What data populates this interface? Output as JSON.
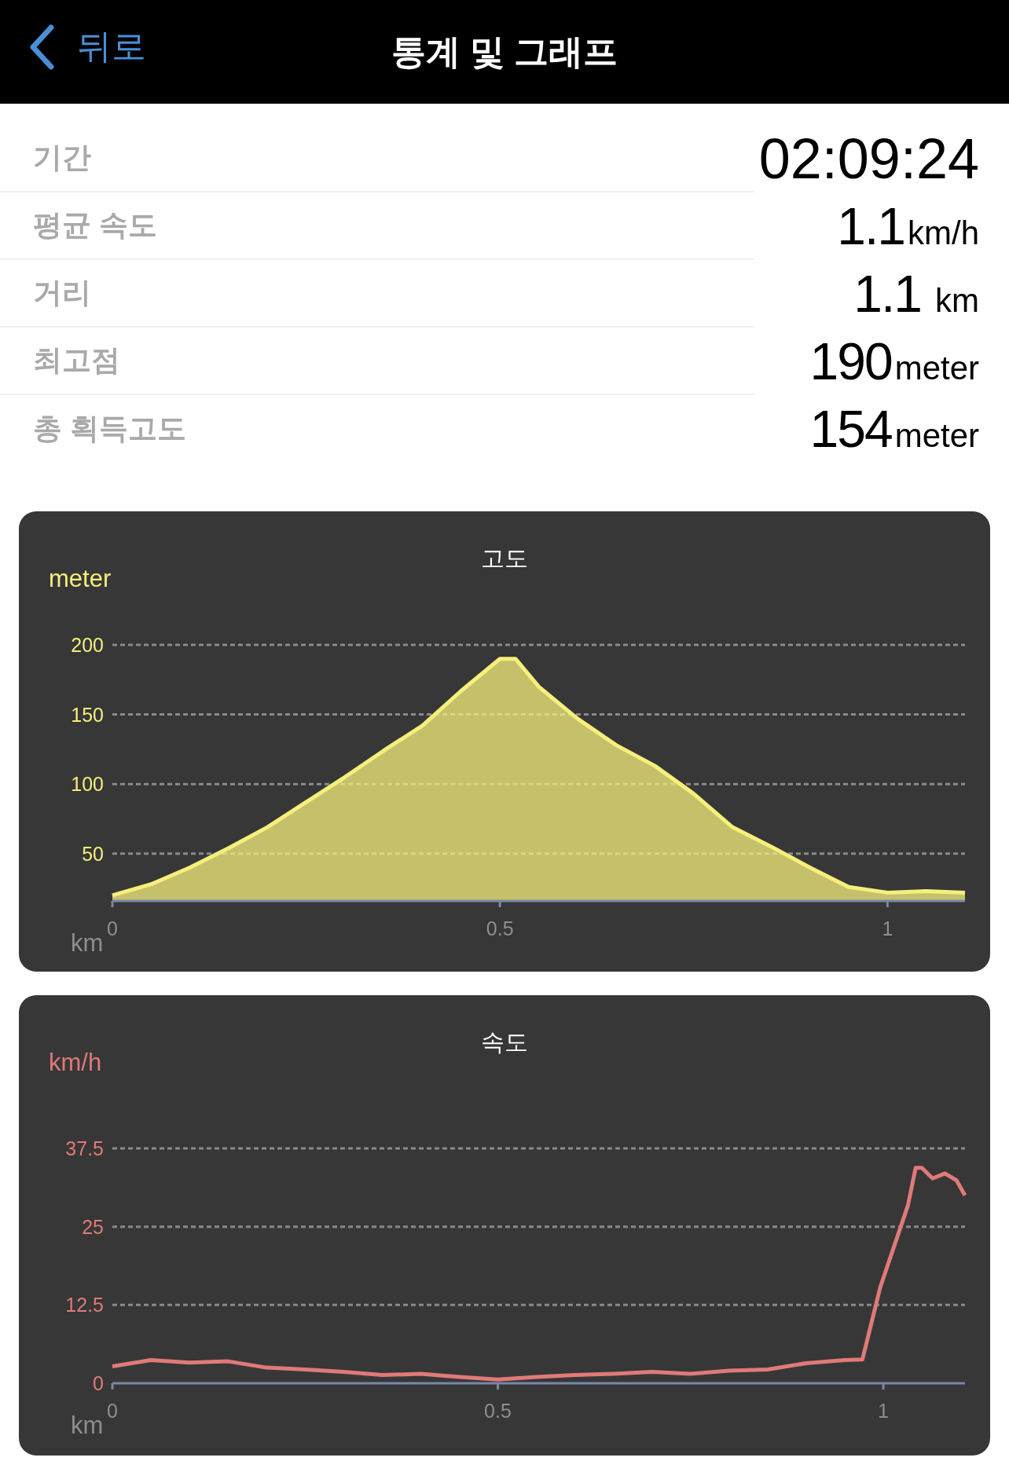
{
  "header": {
    "back_label": "뒤로",
    "title": "통계 및 그래프"
  },
  "stats": [
    {
      "label": "기간",
      "value": "02:09:24"
    },
    {
      "label": "평균 속도",
      "value": "1.1",
      "unit": "km/h"
    },
    {
      "label": "거리",
      "value": "1.1",
      "unit": "km"
    },
    {
      "label": "최고점",
      "value": "190",
      "unit": "meter"
    },
    {
      "label": "총 획득고도",
      "value": "154",
      "unit": "meter"
    }
  ],
  "charts": [
    {
      "chart_data": {
        "type": "area",
        "title": "고도",
        "xlabel": "km",
        "ylabel": "meter",
        "x": [
          0,
          0.05,
          0.1,
          0.15,
          0.2,
          0.25,
          0.3,
          0.35,
          0.4,
          0.45,
          0.5,
          0.52,
          0.55,
          0.6,
          0.65,
          0.7,
          0.75,
          0.8,
          0.85,
          0.9,
          0.95,
          1,
          1.05,
          1.1
        ],
        "series": [
          {
            "color": "#f5ef7c",
            "values": [
              20,
              28,
              40,
              54,
              69,
              87,
              105,
              124,
              142,
              167,
              190,
              190,
              170,
              147,
              128,
              113,
              93,
              69,
              55,
              40,
              26,
              22,
              23,
              22
            ]
          }
        ],
        "xlim": [
          0,
          1.1
        ],
        "ylim": [
          16,
          200
        ],
        "xticks": [
          0,
          0.5,
          1
        ],
        "yticks": [
          50,
          100,
          150,
          200
        ],
        "grid": true
      }
    },
    {
      "chart_data": {
        "type": "line",
        "title": "속도",
        "xlabel": "km",
        "ylabel": "km/h",
        "x": [
          0,
          0.05,
          0.1,
          0.15,
          0.2,
          0.25,
          0.3,
          0.35,
          0.4,
          0.45,
          0.5,
          0.55,
          0.6,
          0.65,
          0.7,
          0.75,
          0.8,
          0.85,
          0.9,
          0.95,
          0.973,
          0.996,
          1.032,
          1.042,
          1.05,
          1.064,
          1.08,
          1.095,
          1.106
        ],
        "series": [
          {
            "color": "#e07a78",
            "values": [
              2.7,
              3.7,
              3.3,
              3.5,
              2.5,
              2.2,
              1.8,
              1.3,
              1.5,
              1.0,
              0.6,
              1.0,
              1.3,
              1.5,
              1.8,
              1.5,
              2.0,
              2.2,
              3.2,
              3.7,
              3.8,
              15.3,
              28.4,
              34.4,
              34.4,
              32.7,
              33.5,
              32.4,
              30
            ]
          }
        ],
        "xlim": [
          0,
          1.106
        ],
        "ylim": [
          0,
          37.5
        ],
        "xticks": [
          0,
          0.5,
          1
        ],
        "yticks": [
          0,
          12.5,
          25,
          37.5
        ],
        "grid": true
      }
    }
  ]
}
